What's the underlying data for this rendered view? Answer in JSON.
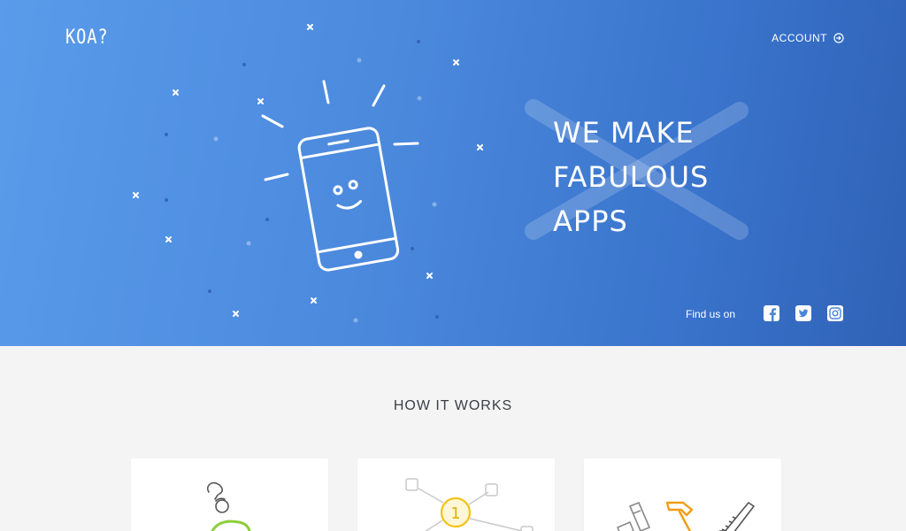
{
  "header": {
    "logo": "KOA?",
    "account_label": "ACCOUNT",
    "account_icon": "sign-in-icon"
  },
  "hero": {
    "headline": [
      "WE MAKE",
      "FABULOUS",
      "APPS"
    ],
    "find_us_label": "Find us on",
    "social": [
      "facebook-icon",
      "twitter-icon",
      "instagram-icon"
    ],
    "illustration": "smiling-phone-icon"
  },
  "how_it_works": {
    "title": "HOW IT WORKS",
    "cards": [
      {
        "icon": "piggy-bank-coin-icon"
      },
      {
        "icon": "network-number-one-icon",
        "badge": "1"
      },
      {
        "icon": "tools-icon"
      }
    ]
  },
  "colors": {
    "hero_start": "#5a9bea",
    "hero_end": "#2f62b6",
    "page_bg": "#f4f4f4",
    "title_text": "#3b3f47",
    "accent_yellow": "#f2c318",
    "accent_green": "#8ccf3a",
    "accent_orange": "#f39c12"
  }
}
